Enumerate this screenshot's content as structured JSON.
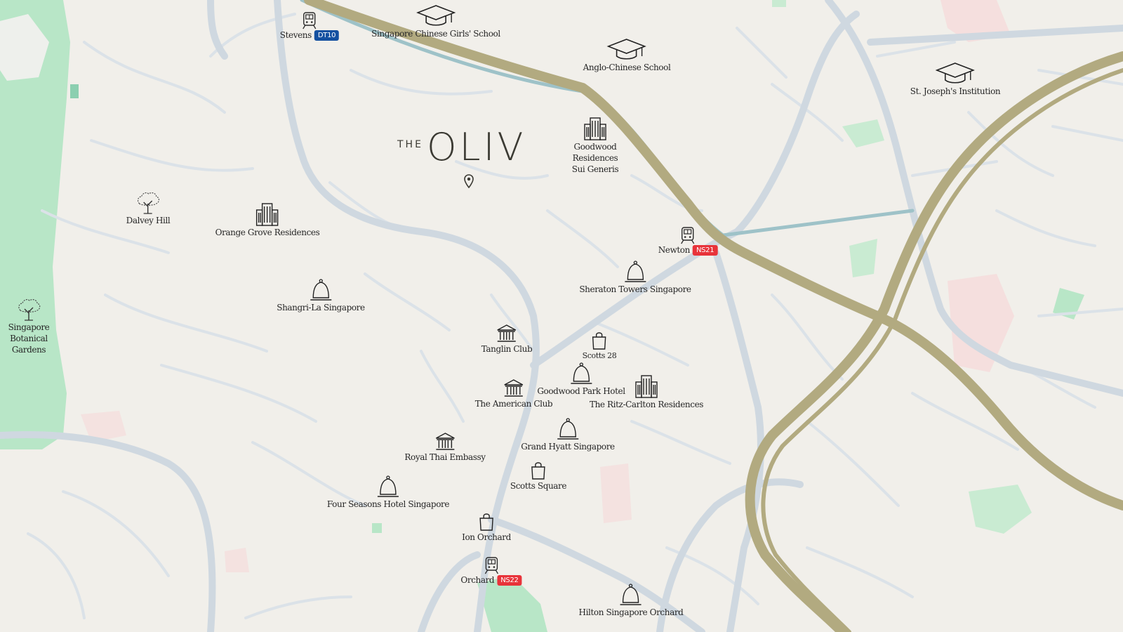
{
  "brand": {
    "prefix": "THE",
    "name": "OLIV"
  },
  "colors": {
    "land": "#f1efea",
    "road": "#d1d9e0",
    "expressway": "#b2aa80",
    "rail": "#9ec2c8",
    "park": "#b8e6c7",
    "zone_pink": "#f7d8d8",
    "badge_downtown": "#1450a0",
    "badge_north_south": "#e8333a"
  },
  "stations": [
    {
      "id": "stevens",
      "label": "Stevens",
      "code": "DT10",
      "line_color": "#1450a0",
      "icon": "train-icon"
    },
    {
      "id": "newton",
      "label": "Newton",
      "code": "NS21",
      "line_color": "#e8333a",
      "icon": "train-icon"
    },
    {
      "id": "orchard",
      "label": "Orchard",
      "code": "NS22",
      "line_color": "#e8333a",
      "icon": "train-icon"
    }
  ],
  "schools": [
    {
      "id": "scgs",
      "label": "Singapore Chinese Girls' School",
      "icon": "graduation-cap-icon"
    },
    {
      "id": "acs",
      "label": "Anglo-Chinese School",
      "icon": "graduation-cap-icon"
    },
    {
      "id": "sji",
      "label": "St. Joseph's Institution",
      "icon": "graduation-cap-icon"
    }
  ],
  "residences": [
    {
      "id": "goodwood",
      "label": "Goodwood Residences\nSui Generis",
      "icon": "building-icon"
    },
    {
      "id": "orange-grove",
      "label": "Orange Grove Residences",
      "icon": "building-icon"
    },
    {
      "id": "ritz",
      "label": "The Ritz-Carlton Residences",
      "icon": "building-icon"
    }
  ],
  "parks": [
    {
      "id": "dalvey",
      "label": "Dalvey Hill",
      "icon": "tree-icon"
    },
    {
      "id": "botanic",
      "label": "Singapore\nBotanical\nGardens",
      "icon": "tree-icon"
    }
  ],
  "hotels": [
    {
      "id": "sheraton",
      "label": "Sheraton Towers Singapore",
      "icon": "bell-icon"
    },
    {
      "id": "shangri-la",
      "label": "Shangri-La Singapore",
      "icon": "bell-icon"
    },
    {
      "id": "goodwood-park",
      "label": "Goodwood Park Hotel",
      "icon": "bell-icon"
    },
    {
      "id": "grand-hyatt",
      "label": "Grand Hyatt Singapore",
      "icon": "bell-icon"
    },
    {
      "id": "four-seasons",
      "label": "Four Seasons Hotel Singapore",
      "icon": "bell-icon"
    },
    {
      "id": "hilton",
      "label": "Hilton Singapore Orchard",
      "icon": "bell-icon"
    }
  ],
  "clubs": [
    {
      "id": "tanglin",
      "label": "Tanglin Club",
      "icon": "classical-building-icon"
    },
    {
      "id": "american",
      "label": "The American Club",
      "icon": "classical-building-icon"
    },
    {
      "id": "thai-embassy",
      "label": "Royal Thai Embassy",
      "icon": "classical-building-icon"
    }
  ],
  "shopping": [
    {
      "id": "scotts28",
      "label": "Scotts 28",
      "icon": "shopping-bag-icon"
    },
    {
      "id": "scotts-square",
      "label": "Scotts Square",
      "icon": "shopping-bag-icon"
    },
    {
      "id": "ion",
      "label": "Ion Orchard",
      "icon": "shopping-bag-icon"
    }
  ]
}
